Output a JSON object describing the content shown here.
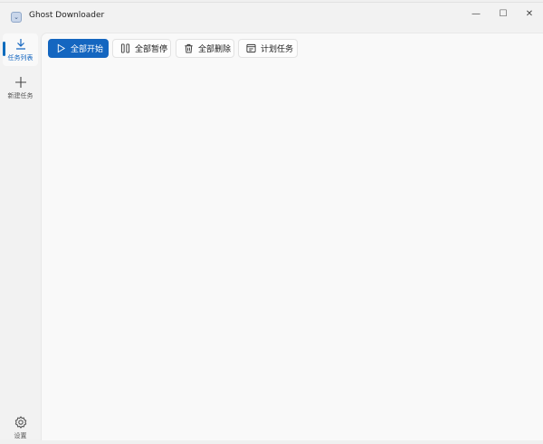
{
  "window": {
    "title": "Ghost Downloader",
    "icon": "app-download-icon"
  },
  "controls": {
    "minimize": "—",
    "maximize": "☐",
    "close": "✕"
  },
  "sidebar": {
    "items": [
      {
        "label": "任务列表",
        "icon": "download-icon",
        "selected": true
      },
      {
        "label": "新建任务",
        "icon": "plus-icon"
      }
    ],
    "settings": {
      "label": "设置",
      "icon": "gear-icon"
    }
  },
  "toolbar": {
    "start_all": "全部开始",
    "pause_all": "全部暂停",
    "delete_all": "全部删除",
    "schedule": "计划任务"
  },
  "colors": {
    "accent": "#1466c0"
  }
}
